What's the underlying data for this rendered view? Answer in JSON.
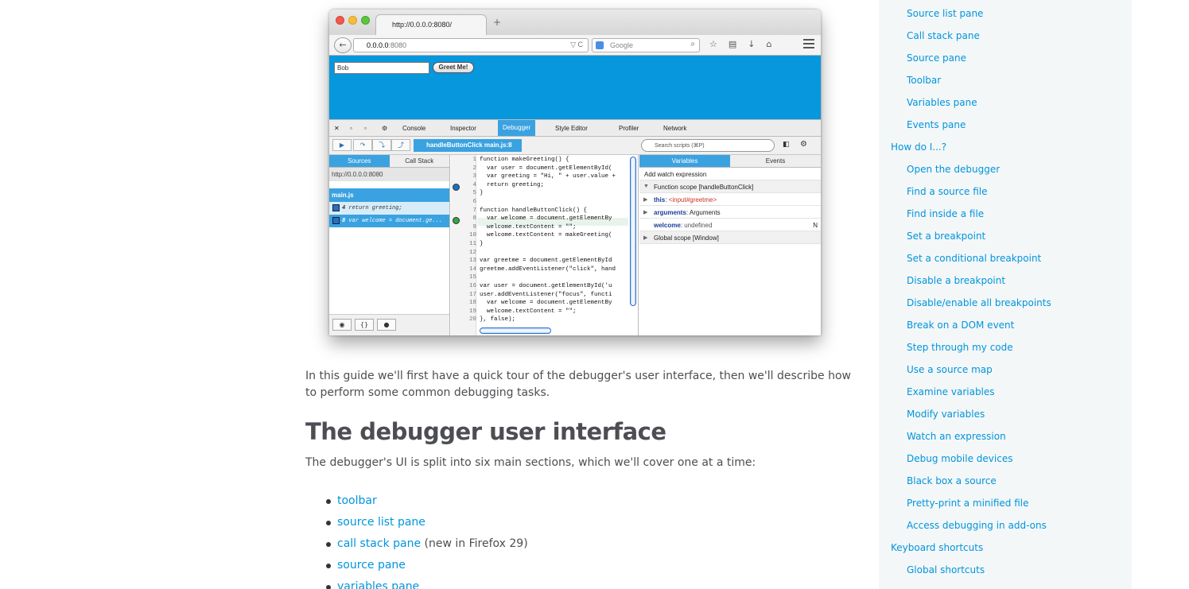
{
  "figure": {
    "tab_title": "http://0.0.0.0:8080/",
    "new_tab": "+",
    "back_glyph": "←",
    "url_host": "0.0.0.0",
    "url_port": ":8080",
    "url_icons": "▽  C",
    "search_placeholder": "Google",
    "search_glyph": "⌕",
    "nav_icons": "☆▤↓⌂",
    "demo_input_value": "Bob",
    "demo_button": "Greet Me!",
    "toolbox_tabs": [
      "Console",
      "Inspector",
      "Debugger",
      "Style Editor",
      "Profiler",
      "Network"
    ],
    "breadcrumb": "handleButtonClick main.js:8",
    "search_scripts": "Search scripts (⌘P)",
    "pane_tabs": [
      "Sources",
      "Call Stack"
    ],
    "source_host": "http://0.0.0.0:8080",
    "source_file": "main.js",
    "breakpoints": [
      {
        "line": "4",
        "code": "return greeting;"
      },
      {
        "line": "8",
        "code": "var welcome = document.ge..."
      }
    ],
    "code_lines": [
      {
        "n": "1",
        "t": "function makeGreeting() {"
      },
      {
        "n": "2",
        "t": "  var user = document.getElementById("
      },
      {
        "n": "3",
        "t": "  var greeting = \"Hi, \" + user.value +"
      },
      {
        "n": "4",
        "t": "  return greeting;"
      },
      {
        "n": "5",
        "t": "}"
      },
      {
        "n": "6",
        "t": ""
      },
      {
        "n": "7",
        "t": "function handleButtonClick() {"
      },
      {
        "n": "8",
        "t": "  var welcome = document.getElementBy"
      },
      {
        "n": "9",
        "t": "  welcome.textContent = \"\";"
      },
      {
        "n": "10",
        "t": "  welcome.textContent = makeGreeting("
      },
      {
        "n": "11",
        "t": "}"
      },
      {
        "n": "12",
        "t": ""
      },
      {
        "n": "13",
        "t": "var greetme = document.getElementById"
      },
      {
        "n": "14",
        "t": "greetme.addEventListener(\"click\", hand"
      },
      {
        "n": "15",
        "t": ""
      },
      {
        "n": "16",
        "t": "var user = document.getElementById('u"
      },
      {
        "n": "17",
        "t": "user.addEventListener(\"focus\", functi"
      },
      {
        "n": "18",
        "t": "  var welcome = document.getElementBy"
      },
      {
        "n": "19",
        "t": "  welcome.textContent = \"\";"
      },
      {
        "n": "20",
        "t": "}, false);"
      }
    ],
    "var_tabs": [
      "Variables",
      "Events"
    ],
    "add_watch": "Add watch expression",
    "function_scope": "Function scope [handleButtonClick]",
    "this_key": "this",
    "this_value": "<input#greetme>",
    "args_key": "arguments",
    "args_value": "Arguments",
    "welcome_key": "welcome",
    "welcome_value": "undefined",
    "welcome_flag": "N",
    "global_scope": "Global scope [Window]"
  },
  "article": {
    "intro": "In this guide we'll first have a quick tour of the debugger's user interface, then we'll describe how to perform some common debugging tasks.",
    "heading": "The debugger user interface",
    "split_text": "The debugger's UI is split into six main sections, which we'll cover one at a time:",
    "sections": [
      {
        "link": "toolbar",
        "note": ""
      },
      {
        "link": "source list pane",
        "note": ""
      },
      {
        "link": "call stack pane",
        "note": "(new in Firefox 29)"
      },
      {
        "link": "source pane",
        "note": ""
      },
      {
        "link": "variables pane",
        "note": ""
      }
    ]
  },
  "sidebar": {
    "items": [
      {
        "label": "Source list pane",
        "level": 2
      },
      {
        "label": "Call stack pane",
        "level": 2
      },
      {
        "label": "Source pane",
        "level": 2
      },
      {
        "label": "Toolbar",
        "level": 2
      },
      {
        "label": "Variables pane",
        "level": 2
      },
      {
        "label": "Events pane",
        "level": 2
      },
      {
        "label": "How do I...?",
        "level": 1
      },
      {
        "label": "Open the debugger",
        "level": 2
      },
      {
        "label": "Find a source file",
        "level": 2
      },
      {
        "label": "Find inside a file",
        "level": 2
      },
      {
        "label": "Set a breakpoint",
        "level": 2
      },
      {
        "label": "Set a conditional breakpoint",
        "level": 2
      },
      {
        "label": "Disable a breakpoint",
        "level": 2
      },
      {
        "label": "Disable/enable all breakpoints",
        "level": 2
      },
      {
        "label": "Break on a DOM event",
        "level": 2
      },
      {
        "label": "Step through my code",
        "level": 2
      },
      {
        "label": "Use a source map",
        "level": 2
      },
      {
        "label": "Examine variables",
        "level": 2
      },
      {
        "label": "Modify variables",
        "level": 2
      },
      {
        "label": "Watch an expression",
        "level": 2
      },
      {
        "label": "Debug mobile devices",
        "level": 2
      },
      {
        "label": "Black box a source",
        "level": 2
      },
      {
        "label": "Pretty-print a minified file",
        "level": 2
      },
      {
        "label": "Access debugging in add-ons",
        "level": 2
      },
      {
        "label": "Keyboard shortcuts",
        "level": 1
      },
      {
        "label": "Global shortcuts",
        "level": 2
      }
    ]
  }
}
